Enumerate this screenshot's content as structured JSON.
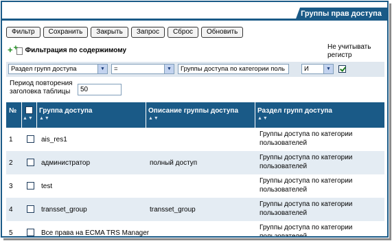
{
  "tab": {
    "title": "Группы прав доступа"
  },
  "toolbar": {
    "buttons": [
      "Фильтр",
      "Сохранить",
      "Закрыть",
      "Запрос",
      "Сброс",
      "Обновить"
    ]
  },
  "filter": {
    "title": "Фильтрация по содержимому",
    "case_label_line1": "Не учитывать",
    "case_label_line2": "регистр",
    "field": "Раздел групп доступа",
    "operator": "=",
    "value": "Группы доступа по категории поль",
    "logic": "И",
    "case_checked": true
  },
  "repeat": {
    "label_line1": "Период повторения",
    "label_line2": "заголовка таблицы",
    "value": "50"
  },
  "table": {
    "columns": [
      "№",
      "",
      "Группа доступа",
      "Описание группы доступа",
      "Раздел групп доступа"
    ],
    "sort_glyph": "▲▼",
    "rows": [
      {
        "num": "1",
        "group": "ais_res1",
        "desc": "",
        "sect1": "Группы доступа по категории",
        "sect2": "пользователей"
      },
      {
        "num": "2",
        "group": "администратор",
        "desc": "полный доступ",
        "sect1": "Группы доступа по категории",
        "sect2": "пользователей"
      },
      {
        "num": "3",
        "group": "test",
        "desc": "",
        "sect1": "Группы доступа по категории",
        "sect2": "пользователей"
      },
      {
        "num": "4",
        "group": "transset_group",
        "desc": "transset_group",
        "sect1": "Группы доступа по категории",
        "sect2": "пользователей"
      },
      {
        "num": "5",
        "group": "Все права на ECMA TRS Manager",
        "desc": "",
        "sect1": "Группы доступа по категории",
        "sect2": "пользователей"
      }
    ]
  }
}
